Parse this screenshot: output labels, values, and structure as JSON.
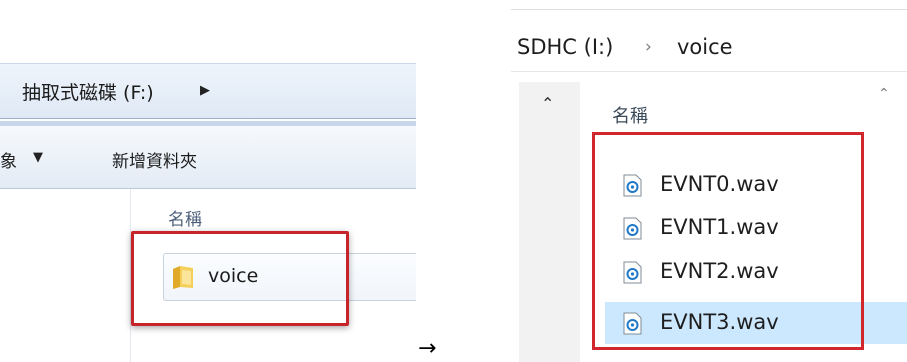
{
  "left_window": {
    "address_path": "抽取式磁碟 (F:)",
    "toolbar_left_fragment": "象",
    "toolbar_new_folder": "新增資料夾",
    "column_header": "名稱",
    "folder_name": "voice",
    "highlight_color": "#c6242a"
  },
  "arrow": "→",
  "right_window": {
    "breadcrumb": [
      "SDHC (I:)",
      "voice"
    ],
    "column_header": "名稱",
    "files": [
      {
        "name": "EVNT0.wav",
        "selected": false
      },
      {
        "name": "EVNT1.wav",
        "selected": false
      },
      {
        "name": "EVNT2.wav",
        "selected": false
      },
      {
        "name": "EVNT3.wav",
        "selected": true
      }
    ],
    "selection_color": "#cce8ff",
    "highlight_color": "#d0262c"
  }
}
